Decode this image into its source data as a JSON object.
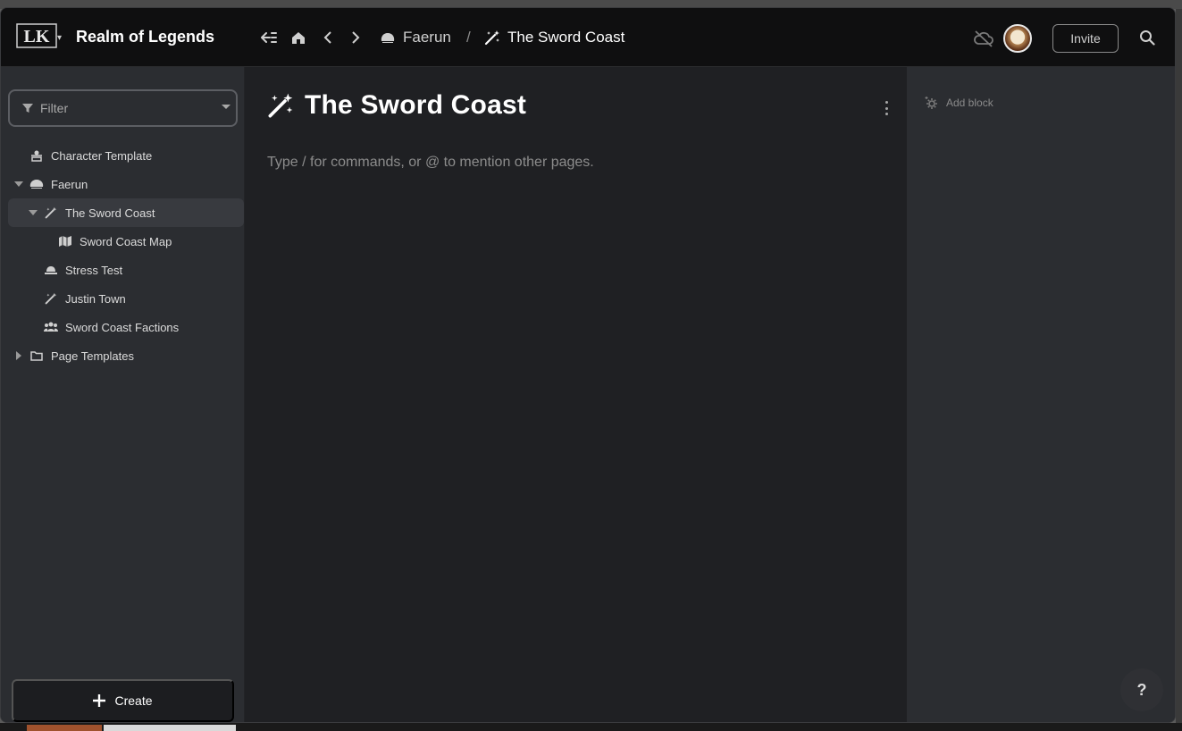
{
  "app": {
    "logo_text": "LK",
    "title": "Realm of Legends"
  },
  "header": {
    "breadcrumbs": [
      {
        "label": "Faerun",
        "icon": "toque-icon"
      },
      {
        "label": "The Sword Coast",
        "icon": "magic-wand-icon"
      }
    ],
    "breadcrumb_separator": "/",
    "invite_label": "Invite"
  },
  "sidebar": {
    "filter_placeholder": "Filter",
    "items": [
      {
        "label": "Character Template",
        "icon": "person-template-icon",
        "depth": 0
      },
      {
        "label": "Faerun",
        "icon": "toque-icon",
        "depth": 0,
        "expanded": true
      },
      {
        "label": "The Sword Coast",
        "icon": "magic-wand-icon",
        "depth": 1,
        "expanded": true,
        "selected": true
      },
      {
        "label": "Sword Coast Map",
        "icon": "map-icon",
        "depth": 2
      },
      {
        "label": "Stress Test",
        "icon": "hat-icon",
        "depth": 1
      },
      {
        "label": "Justin Town",
        "icon": "magic-wand-icon",
        "depth": 1
      },
      {
        "label": "Sword Coast Factions",
        "icon": "users-icon",
        "depth": 1
      },
      {
        "label": "Page Templates",
        "icon": "folder-icon",
        "depth": 0,
        "expanded": false
      }
    ],
    "create_label": "Create"
  },
  "main": {
    "page_title": "The Sword Coast",
    "editor_placeholder": "Type / for commands, or @ to mention other pages."
  },
  "right_panel": {
    "add_block_label": "Add block"
  },
  "help": {
    "label": "?"
  }
}
